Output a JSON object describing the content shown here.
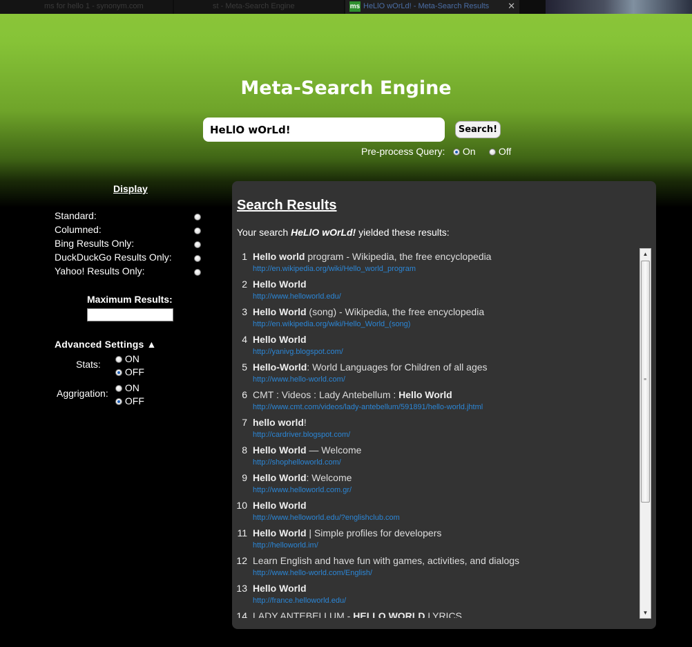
{
  "tabs": [
    {
      "label": "ms for hello 1 - synonym.com"
    },
    {
      "label": "st - Meta-Search Engine"
    },
    {
      "label": "HeLlO wOrLd! - Meta-Search Results",
      "favicon": "ms",
      "close": "✕"
    }
  ],
  "header": {
    "title": "Meta-Search Engine",
    "search_value": "HeLlO wOrLd!",
    "search_button": "Search!",
    "preprocess_label": "Pre-process Query:",
    "preprocess_on": "On",
    "preprocess_off": "Off",
    "preprocess_selected": "On"
  },
  "display": {
    "heading": "Display",
    "options": [
      "Standard:",
      "Columned:",
      "Bing Results Only:",
      "DuckDuckGo Results Only:",
      "Yahoo! Results Only:"
    ],
    "max_results_label": "Maximum Results:",
    "max_results_value": "",
    "advanced_heading": "Advanced Settings ▲",
    "stats_label": "Stats:",
    "aggrigation_label": "Aggrigation:",
    "on_label": "ON",
    "off_label": "OFF",
    "stats_selected": "OFF",
    "aggrigation_selected": "OFF"
  },
  "results": {
    "heading": "Search Results",
    "summary_prefix": "Your search ",
    "summary_query": "HeLlO wOrLd!",
    "summary_suffix": " yielded these results:",
    "items": [
      {
        "n": "1",
        "bold": "Hello world",
        "rest": " program - Wikipedia, the free encyclopedia",
        "url": "http://en.wikipedia.org/wiki/Hello_world_program"
      },
      {
        "n": "2",
        "bold": "Hello World",
        "rest": "",
        "url": "http://www.helloworld.edu/"
      },
      {
        "n": "3",
        "bold": "Hello World",
        "rest": " (song) - Wikipedia, the free encyclopedia",
        "url": "http://en.wikipedia.org/wiki/Hello_World_(song)"
      },
      {
        "n": "4",
        "bold": "Hello World",
        "rest": "",
        "url": "http://yanivg.blogspot.com/"
      },
      {
        "n": "5",
        "bold": "Hello-World",
        "rest": ": World Languages for Children of all ages",
        "url": "http://www.hello-world.com/"
      },
      {
        "n": "6",
        "pre": "CMT : Videos : Lady Antebellum : ",
        "bold": "Hello World",
        "rest": "",
        "url": "http://www.cmt.com/videos/lady-antebellum/591891/hello-world.jhtml"
      },
      {
        "n": "7",
        "bold": "hello world",
        "rest": "!",
        "url": "http://cardriver.blogspot.com/"
      },
      {
        "n": "8",
        "bold": "Hello World",
        "rest": " — Welcome",
        "url": "http://shophelloworld.com/"
      },
      {
        "n": "9",
        "bold": "Hello World",
        "rest": ": Welcome",
        "url": "http://www.helloworld.com.gr/"
      },
      {
        "n": "10",
        "bold": "Hello World",
        "rest": "",
        "url": "http://www.helloworld.edu/?englishclub.com"
      },
      {
        "n": "11",
        "bold": "Hello World",
        "rest": " | Simple profiles for developers",
        "url": "http://helloworld.im/"
      },
      {
        "n": "12",
        "pre": "Learn English and have fun with games, activities, and dialogs",
        "bold": "",
        "rest": "",
        "url": "http://www.hello-world.com/English/"
      },
      {
        "n": "13",
        "bold": "Hello World",
        "rest": "",
        "url": "http://france.helloworld.edu/"
      },
      {
        "n": "14",
        "pre": "LADY ANTEBELLUM - ",
        "bold": "HELLO WORLD",
        "rest": " LYRICS",
        "url": ""
      }
    ]
  },
  "colors": {
    "accent_green": "#8cc63a",
    "panel": "#333333",
    "link": "#2b86d6"
  }
}
